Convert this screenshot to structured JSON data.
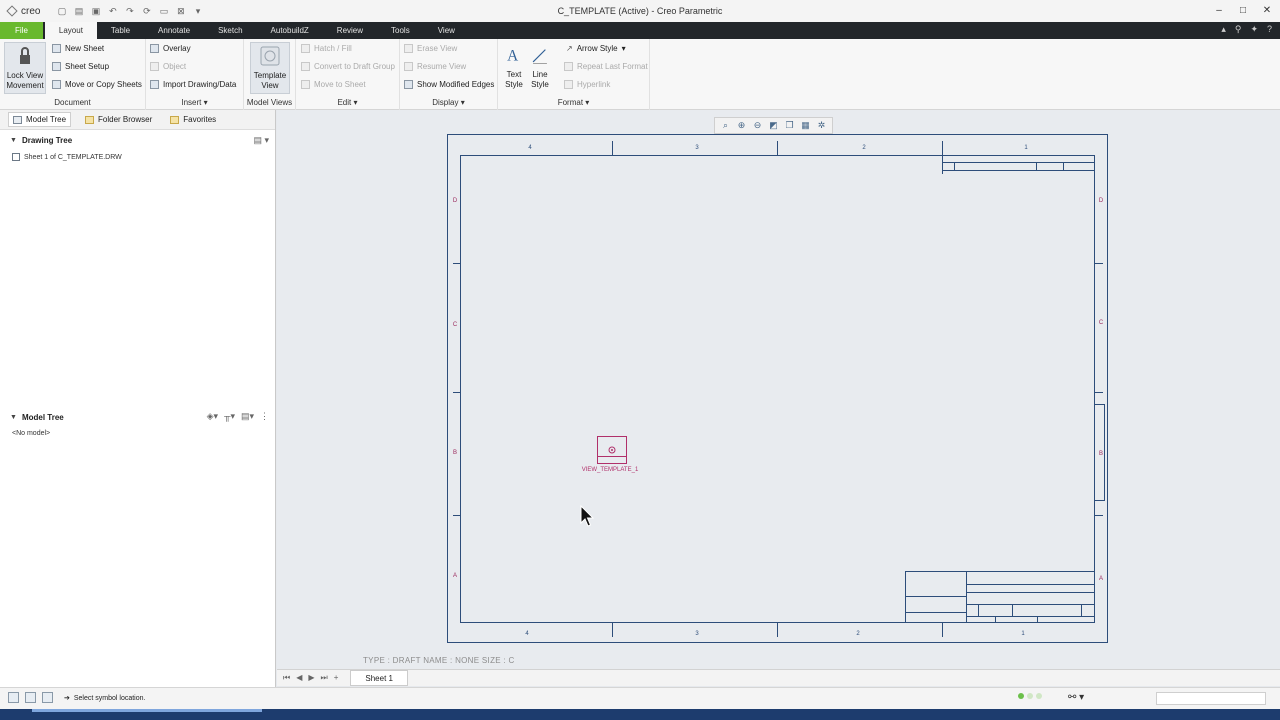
{
  "titlebar": {
    "app_logo": "creo",
    "window_title": "C_TEMPLATE (Active) - Creo Parametric",
    "qat_icons": [
      "new-icon",
      "open-icon",
      "save-icon",
      "undo-icon",
      "redo-icon",
      "regenerate-icon",
      "windows-icon",
      "close-window-icon",
      "customize-icon"
    ],
    "window_controls": {
      "minimize": "–",
      "maximize": "□",
      "close": "✕"
    }
  },
  "tabs": {
    "file": "File",
    "items": [
      "Layout",
      "Table",
      "Annotate",
      "Sketch",
      "AutobuildZ",
      "Review",
      "Tools",
      "View"
    ],
    "active": "Layout"
  },
  "ribbon": {
    "document": {
      "label": "Document",
      "lock_view_line1": "Lock View",
      "lock_view_line2": "Movement",
      "new_sheet": "New Sheet",
      "sheet_setup": "Sheet Setup",
      "move_copy_sheets": "Move or Copy Sheets"
    },
    "insert": {
      "label": "Insert",
      "overlay": "Overlay",
      "object": "Object",
      "import_drawing": "Import Drawing/Data"
    },
    "model_views": {
      "label": "Model Views",
      "template_view_line1": "Template",
      "template_view_line2": "View"
    },
    "edit": {
      "label": "Edit",
      "hatch_fill": "Hatch / Fill",
      "convert_draft": "Convert to Draft Group",
      "move_to_sheet": "Move to Sheet"
    },
    "display": {
      "label": "Display",
      "erase_view": "Erase View",
      "resume_view": "Resume View",
      "show_modified_edges": "Show Modified Edges"
    },
    "format": {
      "label": "Format",
      "text_style_line1": "Text",
      "text_style_line2": "Style",
      "line_style_line1": "Line",
      "line_style_line2": "Style",
      "arrow_style": "Arrow Style",
      "repeat_last_format": "Repeat Last Format",
      "hyperlink": "Hyperlink"
    }
  },
  "leftpanel": {
    "tabs": [
      "Model Tree",
      "Folder Browser",
      "Favorites"
    ],
    "drawing_tree_title": "Drawing Tree",
    "drawing_tree_item": "Sheet 1 of C_TEMPLATE.DRW",
    "model_tree_title": "Model Tree",
    "model_tree_item": "<No model>"
  },
  "graphics": {
    "toolbar_icons": [
      "refit-icon",
      "zoom-in-icon",
      "zoom-out-icon",
      "repaint-icon",
      "named-views-icon",
      "display-style-icon",
      "spin-center-icon"
    ],
    "zone_numbers_top": [
      "4",
      "3",
      "2",
      "1"
    ],
    "zone_numbers_bottom": [
      "4",
      "3",
      "2",
      "1"
    ],
    "zone_letters_left": [
      "D",
      "C",
      "B",
      "A"
    ],
    "zone_letters_right": [
      "D",
      "C",
      "B",
      "A"
    ],
    "view_symbol_label": "VIEW_TEMPLATE_1",
    "sheet_info": "TYPE : DRAFT    NAME : NONE    SIZE : C"
  },
  "sheetbar": {
    "nav_buttons": [
      "⏮",
      "◀",
      "▶",
      "⏭",
      "+"
    ],
    "sheet_tab": "Sheet 1"
  },
  "statusbar": {
    "message": "Select symbol location."
  },
  "colors": {
    "file_tab": "#69b92e",
    "tab_bar": "#22262a",
    "drawing_border": "#2d4d7a",
    "symbol": "#b0306a"
  }
}
